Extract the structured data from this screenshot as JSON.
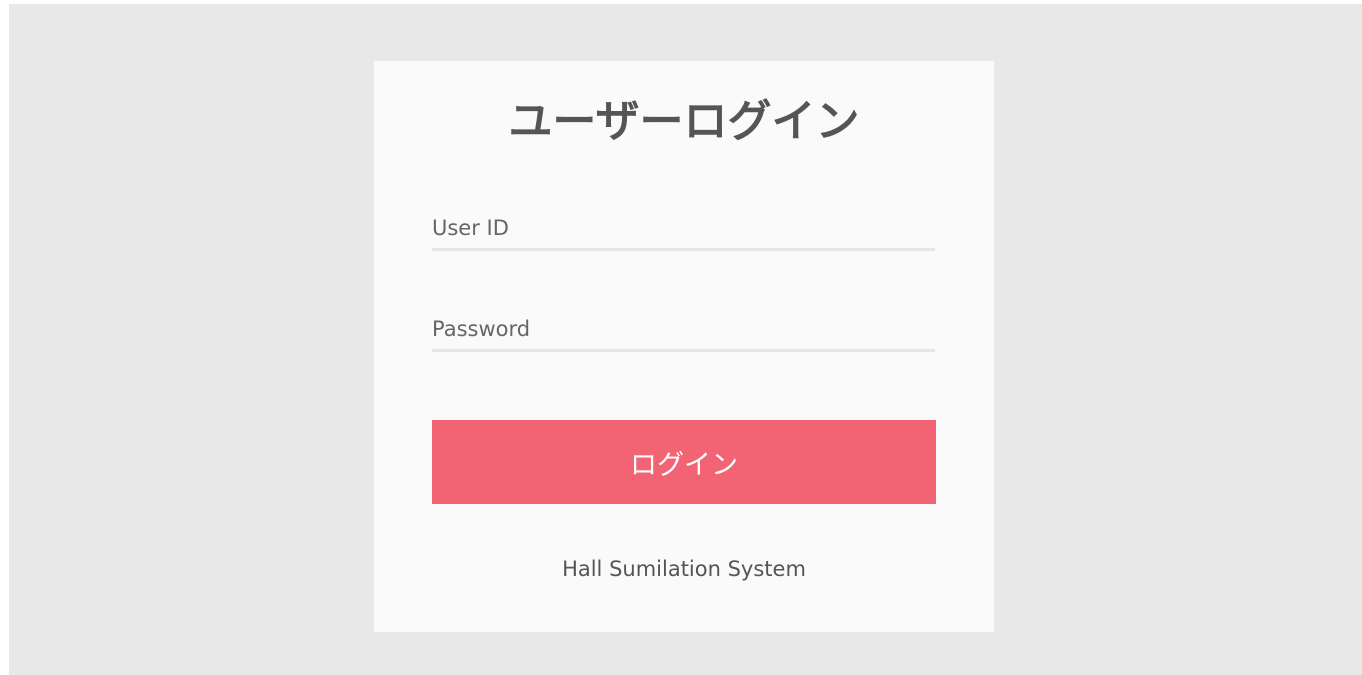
{
  "login": {
    "title": "ユーザーログイン",
    "user_id": {
      "placeholder": "User ID",
      "value": ""
    },
    "password": {
      "placeholder": "Password",
      "value": ""
    },
    "submit_label": "ログイン",
    "footer_text": "Hall Sumilation System"
  },
  "colors": {
    "page_background": "#e8e8e8",
    "card_background": "#fafafa",
    "accent_button": "#f26374",
    "title_text": "#555555",
    "input_underline": "#e5e5e5"
  }
}
